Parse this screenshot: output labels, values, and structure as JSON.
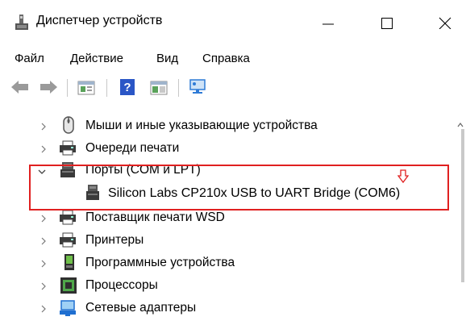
{
  "window": {
    "title": "Диспетчер устройств",
    "minimize": "minimize",
    "maximize": "maximize",
    "close": "close"
  },
  "menu": [
    "Файл",
    "Действие",
    "Вид",
    "Справка"
  ],
  "toolbar": [
    {
      "icon": "back-arrow-icon"
    },
    {
      "icon": "forward-arrow-icon"
    },
    {
      "icon": "properties-icon"
    },
    {
      "icon": "help-icon"
    },
    {
      "icon": "show-hide-console-tree-icon"
    },
    {
      "icon": "scan-hardware-icon"
    }
  ],
  "tree": [
    {
      "label": "Мыши и иные указывающие устройства",
      "state": "collapsed",
      "icon": "mouse-icon"
    },
    {
      "label": "Очереди печати",
      "state": "collapsed",
      "icon": "printer-icon"
    },
    {
      "label": "Порты (COM и LPT)",
      "state": "expanded",
      "icon": "port-icon"
    },
    {
      "label": "Silicon Labs CP210x USB to UART Bridge (COM6)",
      "state": "child",
      "icon": "port-icon"
    },
    {
      "label": "Поставщик печати WSD",
      "state": "collapsed",
      "icon": "printer-icon"
    },
    {
      "label": "Принтеры",
      "state": "collapsed",
      "icon": "printer-icon"
    },
    {
      "label": "Программные устройства",
      "state": "collapsed",
      "icon": "software-device-icon"
    },
    {
      "label": "Процессоры",
      "state": "collapsed",
      "icon": "processor-icon"
    },
    {
      "label": "Сетевые адаптеры",
      "state": "collapsed",
      "icon": "network-adapter-icon"
    }
  ],
  "colors": {
    "highlight": "#e02020",
    "icon_blue": "#1f6fd1"
  }
}
